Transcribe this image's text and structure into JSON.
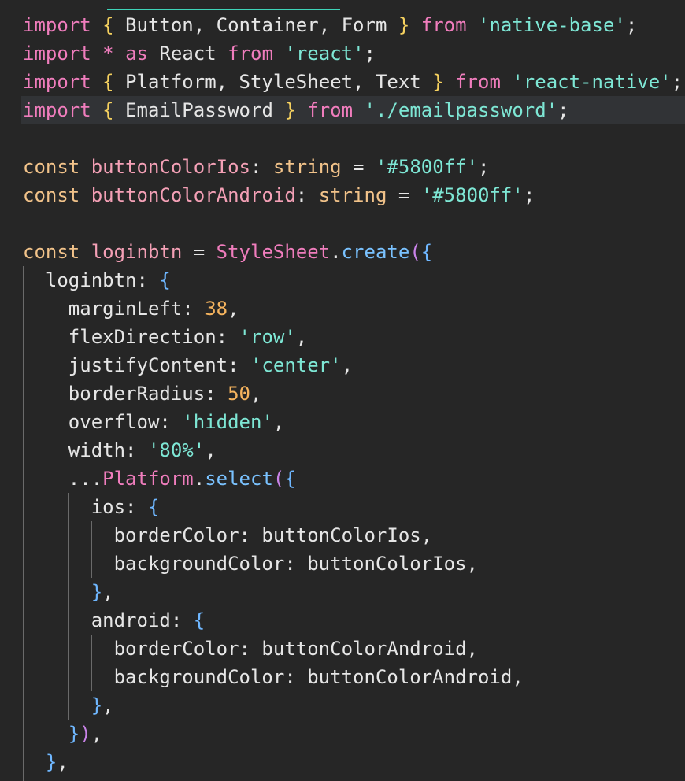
{
  "lines": [
    {
      "tokens": [
        {
          "t": "import",
          "c": "kw"
        },
        {
          "t": " ",
          "c": "plain"
        },
        {
          "t": "{",
          "c": "brace-y"
        },
        {
          "t": " Button, Container, Form ",
          "c": "plain"
        },
        {
          "t": "}",
          "c": "brace-y"
        },
        {
          "t": " ",
          "c": "plain"
        },
        {
          "t": "from",
          "c": "kw"
        },
        {
          "t": " ",
          "c": "plain"
        },
        {
          "t": "'native-base'",
          "c": "str"
        },
        {
          "t": ";",
          "c": "plain"
        }
      ]
    },
    {
      "tokens": [
        {
          "t": "import",
          "c": "kw"
        },
        {
          "t": " ",
          "c": "plain"
        },
        {
          "t": "*",
          "c": "kw"
        },
        {
          "t": " ",
          "c": "plain"
        },
        {
          "t": "as",
          "c": "kw"
        },
        {
          "t": " React ",
          "c": "plain"
        },
        {
          "t": "from",
          "c": "kw"
        },
        {
          "t": " ",
          "c": "plain"
        },
        {
          "t": "'react'",
          "c": "str"
        },
        {
          "t": ";",
          "c": "plain"
        }
      ]
    },
    {
      "tokens": [
        {
          "t": "import",
          "c": "kw"
        },
        {
          "t": " ",
          "c": "plain"
        },
        {
          "t": "{",
          "c": "brace-y"
        },
        {
          "t": " Platform, StyleSheet, Text ",
          "c": "plain"
        },
        {
          "t": "}",
          "c": "brace-y"
        },
        {
          "t": " ",
          "c": "plain"
        },
        {
          "t": "from",
          "c": "kw"
        },
        {
          "t": " ",
          "c": "plain"
        },
        {
          "t": "'react-native'",
          "c": "str"
        },
        {
          "t": ";",
          "c": "plain"
        }
      ]
    },
    {
      "highlighted": true,
      "tokens": [
        {
          "t": "import",
          "c": "kw"
        },
        {
          "t": " ",
          "c": "plain"
        },
        {
          "t": "{",
          "c": "brace-y"
        },
        {
          "t": " EmailPassword ",
          "c": "plain"
        },
        {
          "t": "}",
          "c": "brace-y"
        },
        {
          "t": " ",
          "c": "plain"
        },
        {
          "t": "from",
          "c": "kw"
        },
        {
          "t": " ",
          "c": "plain"
        },
        {
          "t": "'./emailpassword'",
          "c": "str"
        },
        {
          "t": ";",
          "c": "plain"
        }
      ]
    },
    {
      "tokens": []
    },
    {
      "tokens": [
        {
          "t": "const",
          "c": "decl"
        },
        {
          "t": " ",
          "c": "plain"
        },
        {
          "t": "buttonColorIos",
          "c": "var"
        },
        {
          "t": ": ",
          "c": "plain"
        },
        {
          "t": "string",
          "c": "decl"
        },
        {
          "t": " = ",
          "c": "plain"
        },
        {
          "t": "'#5800ff'",
          "c": "str"
        },
        {
          "t": ";",
          "c": "plain"
        }
      ]
    },
    {
      "tokens": [
        {
          "t": "const",
          "c": "decl"
        },
        {
          "t": " ",
          "c": "plain"
        },
        {
          "t": "buttonColorAndroid",
          "c": "var"
        },
        {
          "t": ": ",
          "c": "plain"
        },
        {
          "t": "string",
          "c": "decl"
        },
        {
          "t": " = ",
          "c": "plain"
        },
        {
          "t": "'#5800ff'",
          "c": "str"
        },
        {
          "t": ";",
          "c": "plain"
        }
      ]
    },
    {
      "tokens": []
    },
    {
      "tokens": [
        {
          "t": "const",
          "c": "decl"
        },
        {
          "t": " ",
          "c": "plain"
        },
        {
          "t": "loginbtn",
          "c": "var"
        },
        {
          "t": " = ",
          "c": "plain"
        },
        {
          "t": "StyleSheet",
          "c": "cls"
        },
        {
          "t": ".",
          "c": "plain"
        },
        {
          "t": "create",
          "c": "func"
        },
        {
          "t": "(",
          "c": "brace-p"
        },
        {
          "t": "{",
          "c": "brace-b"
        }
      ]
    },
    {
      "tokens": [
        {
          "t": "  loginbtn: ",
          "c": "plain"
        },
        {
          "t": "{",
          "c": "brace-b"
        }
      ]
    },
    {
      "tokens": [
        {
          "t": "    marginLeft: ",
          "c": "plain"
        },
        {
          "t": "38",
          "c": "num"
        },
        {
          "t": ",",
          "c": "plain"
        }
      ]
    },
    {
      "tokens": [
        {
          "t": "    flexDirection: ",
          "c": "plain"
        },
        {
          "t": "'row'",
          "c": "str"
        },
        {
          "t": ",",
          "c": "plain"
        }
      ]
    },
    {
      "tokens": [
        {
          "t": "    justifyContent: ",
          "c": "plain"
        },
        {
          "t": "'center'",
          "c": "str"
        },
        {
          "t": ",",
          "c": "plain"
        }
      ]
    },
    {
      "tokens": [
        {
          "t": "    borderRadius: ",
          "c": "plain"
        },
        {
          "t": "50",
          "c": "num"
        },
        {
          "t": ",",
          "c": "plain"
        }
      ]
    },
    {
      "tokens": [
        {
          "t": "    overflow: ",
          "c": "plain"
        },
        {
          "t": "'hidden'",
          "c": "str"
        },
        {
          "t": ",",
          "c": "plain"
        }
      ]
    },
    {
      "tokens": [
        {
          "t": "    width: ",
          "c": "plain"
        },
        {
          "t": "'80%'",
          "c": "str"
        },
        {
          "t": ",",
          "c": "plain"
        }
      ]
    },
    {
      "tokens": [
        {
          "t": "    ...",
          "c": "plain"
        },
        {
          "t": "Platform",
          "c": "cls"
        },
        {
          "t": ".",
          "c": "plain"
        },
        {
          "t": "select",
          "c": "func"
        },
        {
          "t": "(",
          "c": "brace-p"
        },
        {
          "t": "{",
          "c": "brace-b"
        }
      ]
    },
    {
      "tokens": [
        {
          "t": "      ios: ",
          "c": "plain"
        },
        {
          "t": "{",
          "c": "brace-b"
        }
      ]
    },
    {
      "tokens": [
        {
          "t": "        borderColor: buttonColorIos,",
          "c": "plain"
        }
      ]
    },
    {
      "tokens": [
        {
          "t": "        backgroundColor: buttonColorIos,",
          "c": "plain"
        }
      ]
    },
    {
      "tokens": [
        {
          "t": "      ",
          "c": "plain"
        },
        {
          "t": "}",
          "c": "brace-b"
        },
        {
          "t": ",",
          "c": "plain"
        }
      ]
    },
    {
      "tokens": [
        {
          "t": "      android: ",
          "c": "plain"
        },
        {
          "t": "{",
          "c": "brace-b"
        }
      ]
    },
    {
      "tokens": [
        {
          "t": "        borderColor: buttonColorAndroid,",
          "c": "plain"
        }
      ]
    },
    {
      "tokens": [
        {
          "t": "        backgroundColor: buttonColorAndroid,",
          "c": "plain"
        }
      ]
    },
    {
      "tokens": [
        {
          "t": "      ",
          "c": "plain"
        },
        {
          "t": "}",
          "c": "brace-b"
        },
        {
          "t": ",",
          "c": "plain"
        }
      ]
    },
    {
      "tokens": [
        {
          "t": "    ",
          "c": "plain"
        },
        {
          "t": "}",
          "c": "brace-b"
        },
        {
          "t": ")",
          "c": "brace-p"
        },
        {
          "t": ",",
          "c": "plain"
        }
      ]
    },
    {
      "tokens": [
        {
          "t": "  ",
          "c": "plain"
        },
        {
          "t": "}",
          "c": "brace-b"
        },
        {
          "t": ",",
          "c": "plain"
        }
      ]
    }
  ],
  "colors": {
    "background": "#262626",
    "keyword": "#f07dbd",
    "declaration": "#f2c38a",
    "string": "#7ee7d5",
    "number": "#f6b45e",
    "function": "#7ac2ff"
  }
}
